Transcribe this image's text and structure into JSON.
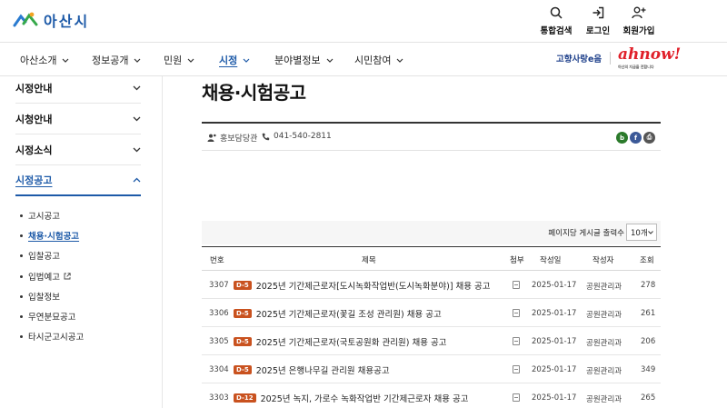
{
  "header": {
    "logo_text": "아산시",
    "util": [
      {
        "icon": "search-icon",
        "label": "통합검색"
      },
      {
        "icon": "login-icon",
        "label": "로그인"
      },
      {
        "icon": "user-add-icon",
        "label": "회원가입"
      }
    ]
  },
  "gnb": {
    "items": [
      "아산소개",
      "정보공개",
      "민원",
      "시정",
      "분야별정보",
      "시민참여"
    ],
    "active_index": 3,
    "slogan": "고향사랑e음",
    "brand": "ahnow!",
    "brand_sub": "아산의 지금을 전합니다"
  },
  "sidebar": {
    "items": [
      "시정안내",
      "시청안내",
      "시정소식",
      "시정공고"
    ],
    "active": "시정공고",
    "sub_items": [
      "고시공고",
      "채용·시험공고",
      "입찰공고",
      "입법예고",
      "입찰정보",
      "무연분묘공고",
      "타시군고시공고"
    ],
    "active_sub": "채용·시험공고"
  },
  "content": {
    "title": "채용·시험공고",
    "dept": "홍보담당관",
    "phone": "041-540-2811",
    "share": [
      {
        "label": "b",
        "color": "#2b7a2b"
      },
      {
        "label": "f",
        "color": "#3b5998"
      },
      {
        "label": "⎙",
        "color": "#555555"
      }
    ],
    "perpage_label": "페이지당 게시글 출력수",
    "perpage_value": "10개",
    "table": {
      "headers": [
        "번호",
        "제목",
        "첨부",
        "작성일",
        "작성자",
        "조회"
      ],
      "rows": [
        {
          "no": "3307",
          "badge": "D-5",
          "title": "2025년 기간제근로자[도시녹화작업반(도시녹화분야)] 채용 공고",
          "date": "2025-01-17",
          "author": "공원관리과",
          "views": "278"
        },
        {
          "no": "3306",
          "badge": "D-5",
          "title": "2025년 기간제근로자(꽃길 조성 관리원) 채용 공고",
          "date": "2025-01-17",
          "author": "공원관리과",
          "views": "261"
        },
        {
          "no": "3305",
          "badge": "D-5",
          "title": "2025년 기간제근로자(국토공원화 관리원) 채용 공고",
          "date": "2025-01-17",
          "author": "공원관리과",
          "views": "206"
        },
        {
          "no": "3304",
          "badge": "D-5",
          "title": "2025년 은행나무길 관리원 채용공고",
          "date": "2025-01-17",
          "author": "공원관리과",
          "views": "349"
        },
        {
          "no": "3303",
          "badge": "D-12",
          "title": "2025년 녹지, 가로수 녹화작업반 기간제근로자 채용 공고",
          "date": "2025-01-17",
          "author": "공원관리과",
          "views": "265"
        }
      ]
    }
  }
}
